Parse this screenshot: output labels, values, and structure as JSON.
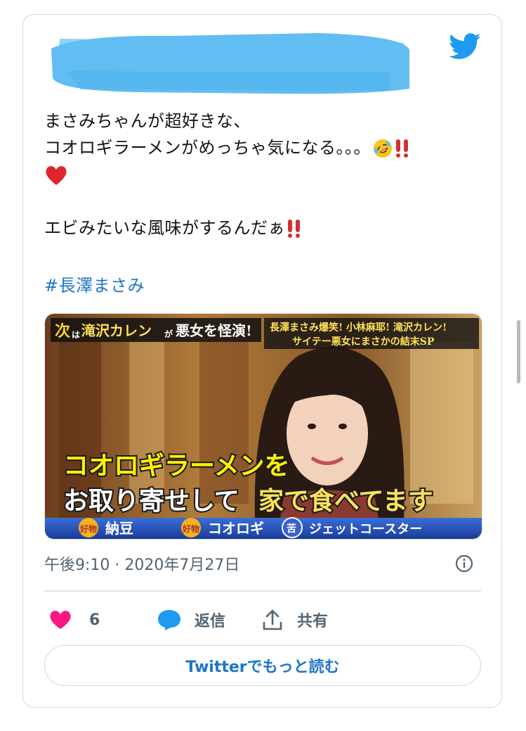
{
  "tweet": {
    "text_lines": [
      "まさみちゃんが超好きな、",
      "コオロギラーメンがめっちゃ気になる。。。",
      "",
      "",
      "エビみたいな風味がするんだぁ"
    ],
    "hashtag": "#長澤まさみ",
    "timestamp": "午後9:10 · 2020年7月27日"
  },
  "media": {
    "top_left_caption_1": "次",
    "top_left_caption_2": "は",
    "top_left_caption_3": "滝沢カレン",
    "top_left_caption_4": "が",
    "top_left_caption_5": "悪女を怪演!",
    "top_right_line_1": "長澤まさみ爆笑! 小林麻耶! 滝沢カレン!",
    "top_right_line_2": "サイテー悪女にまさかの結末SP",
    "main_caption_1": "コオロギラーメンを",
    "main_caption_2a": "お取り寄せして",
    "main_caption_2b": "家で食べてます",
    "bottom_1a": "好物",
    "bottom_1b": "納豆",
    "bottom_2a": "好物",
    "bottom_2b": "コオロギ",
    "bottom_3a": "苦",
    "bottom_3b": "ジェットコースター"
  },
  "actions": {
    "like_count": "6",
    "reply_label": "返信",
    "share_label": "共有"
  },
  "read_more_label": "Twitterでもっと読む",
  "colors": {
    "link": "#1d76c8",
    "twitter_blue": "#1d9bf0",
    "like_pink": "#f91880",
    "redaction": "#5ab9f0"
  },
  "icons": [
    "twitter-bird-icon",
    "rofl-emoji-icon",
    "double-exclamation-icon",
    "red-heart-icon",
    "info-icon",
    "heart-icon",
    "reply-bubble-icon",
    "share-icon"
  ]
}
